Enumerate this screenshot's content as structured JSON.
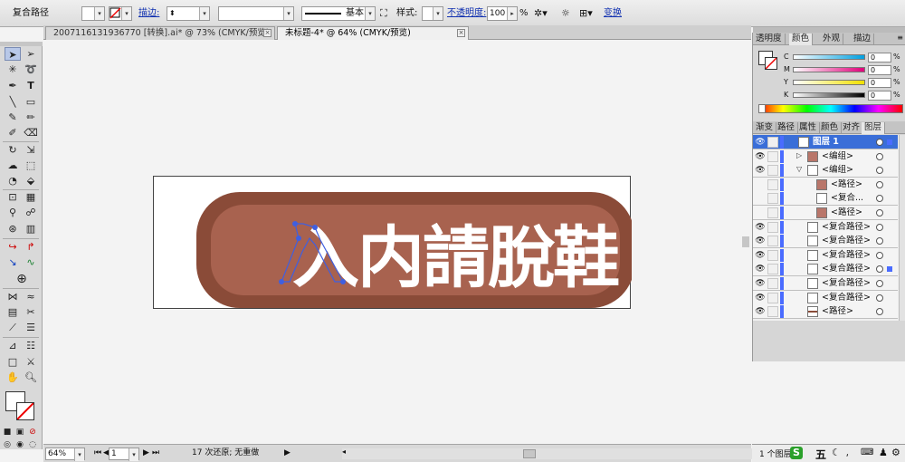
{
  "control_bar": {
    "tool_name": "复合路径",
    "stroke_label": "描边:",
    "stroke_weight": "",
    "stroke_profile_label": "基本",
    "style_label": "样式:",
    "opacity_label": "不透明度:",
    "opacity_value": "100",
    "opacity_unit": "%",
    "transform_link": "变换"
  },
  "tabs": [
    {
      "label": "2007116131936770 [转换].ai* @ 73% (CMYK/预览)",
      "close": "×"
    },
    {
      "label": "未标题-4* @ 64% (CMYK/预览)",
      "close": "×"
    }
  ],
  "artwork": {
    "text": "入内請脫鞋",
    "button_outer_color": "#8a4b38",
    "button_inner_color": "#a8624f",
    "text_color": "#ffffff",
    "selection_color": "#3f5fe0"
  },
  "color_panel": {
    "tabs": [
      "透明度",
      "颜色",
      "外观",
      "描边"
    ],
    "channels": [
      {
        "label": "C",
        "value": "0",
        "unit": "%",
        "gradient": "linear-gradient(90deg,#fff,#00a0e0)"
      },
      {
        "label": "M",
        "value": "0",
        "unit": "%",
        "gradient": "linear-gradient(90deg,#fff,#e0007a)"
      },
      {
        "label": "Y",
        "value": "0",
        "unit": "%",
        "gradient": "linear-gradient(90deg,#fff,#f0e000)"
      },
      {
        "label": "K",
        "value": "0",
        "unit": "%",
        "gradient": "linear-gradient(90deg,#fff,#000)"
      }
    ]
  },
  "layers_panel": {
    "tabs": [
      "渐变",
      "路径",
      "属性",
      "颜色",
      "对齐",
      "图层"
    ],
    "rows": [
      {
        "name": "图层 1",
        "indent": 0
      },
      {
        "name": "<编组>",
        "indent": 1
      },
      {
        "name": "<编组>",
        "indent": 1
      },
      {
        "name": "<路径>",
        "indent": 2
      },
      {
        "name": "<复合...",
        "indent": 2
      },
      {
        "name": "<路径>",
        "indent": 2
      },
      {
        "name": "<复合路径>",
        "indent": 1
      },
      {
        "name": "<复合路径>",
        "indent": 1
      },
      {
        "name": "<复合路径>",
        "indent": 1
      },
      {
        "name": "<复合路径>",
        "indent": 1
      },
      {
        "name": "<复合路径>",
        "indent": 1
      },
      {
        "name": "<复合路径>",
        "indent": 1
      },
      {
        "name": "<路径>",
        "indent": 1
      }
    ],
    "footer": "1 个图层"
  },
  "status_bar": {
    "zoom": "64%",
    "page": "1",
    "history": "17 次还原; 无重做"
  },
  "taskbar": {
    "ime": "五"
  }
}
